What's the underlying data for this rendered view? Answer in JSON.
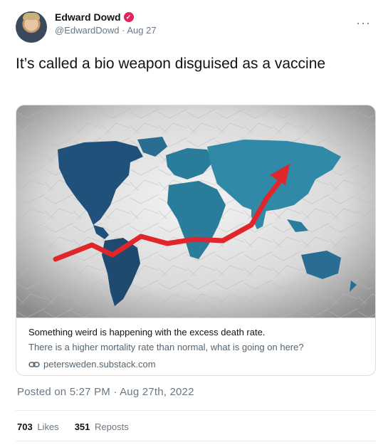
{
  "author": {
    "name": "Edward Dowd",
    "verified_mark": "✓",
    "handle": "@EdwardDowd",
    "separator": "·",
    "date": "Aug 27"
  },
  "more_icon": "···",
  "tweet": {
    "text": "It’s called a bio weapon disguised as a vaccine"
  },
  "card": {
    "image": "world-map-with-rising-red-arrow",
    "title": "Something weird is happening with the excess death rate.",
    "description": "There is a higher mortality rate than normal, what is going on here?",
    "domain": "petersweden.substack.com"
  },
  "posted": "Posted on 5:27 PM · Aug 27th, 2022",
  "stats": {
    "likes_count": "703",
    "likes_label": "Likes",
    "reposts_count": "351",
    "reposts_label": "Reposts"
  },
  "colors": {
    "verified": "#e0245e",
    "arrow": "#e0262a",
    "map_land": "#2a7c9b",
    "muted": "#6b7782"
  }
}
